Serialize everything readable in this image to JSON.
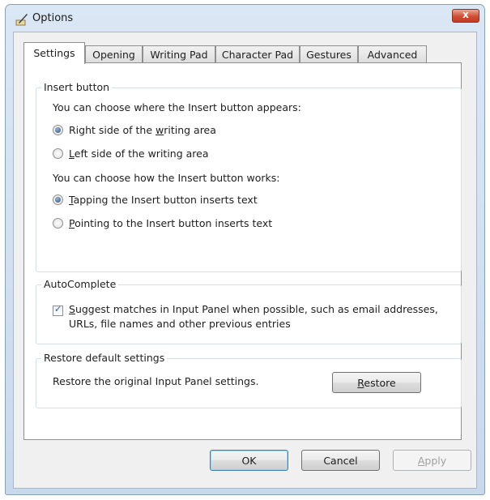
{
  "window": {
    "title": "Options",
    "close_label": "x"
  },
  "tabs": [
    {
      "label": "Settings",
      "active": true
    },
    {
      "label": "Opening"
    },
    {
      "label": "Writing Pad"
    },
    {
      "label": "Character Pad"
    },
    {
      "label": "Gestures"
    },
    {
      "label": "Advanced"
    }
  ],
  "insert_group": {
    "title": "Insert button",
    "where_prompt": "You can choose where the Insert button appears:",
    "right_side_label_pre": "Right side of the ",
    "right_side_label_u": "w",
    "right_side_label_post": "riting area",
    "left_side_label_u": "L",
    "left_side_label_post": "eft side of the writing area",
    "how_prompt": "You can choose how the Insert button works:",
    "tapping_label_u": "T",
    "tapping_label_post": "apping the Insert button inserts text",
    "pointing_label_u": "P",
    "pointing_label_post": "ointing to the Insert button inserts text",
    "selected_position": "Right side of the writing area",
    "selected_behavior": "Tapping the Insert button inserts text"
  },
  "autocomplete_group": {
    "title": "AutoComplete",
    "suggest_label_u": "S",
    "suggest_label_line1": "uggest matches in Input Panel when possible, such as email addresses,",
    "suggest_label_line2": "URLs, file names and other previous entries",
    "suggest_checked": true
  },
  "restore_group": {
    "title": "Restore default settings",
    "description": "Restore the original Input Panel settings.",
    "restore_button_u": "R",
    "restore_button_post": "estore"
  },
  "footer": {
    "ok_label": "OK",
    "cancel_label": "Cancel",
    "apply_label_u": "A",
    "apply_label_post": "pply"
  }
}
